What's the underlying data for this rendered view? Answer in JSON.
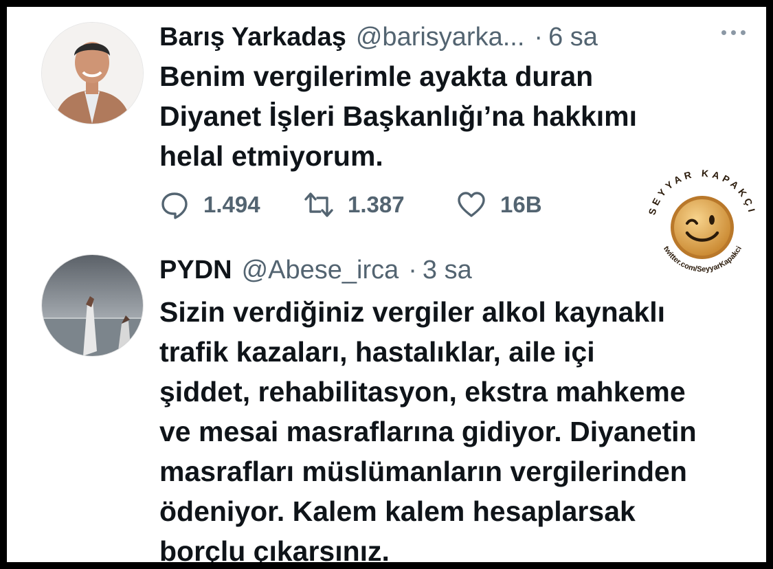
{
  "tweets": [
    {
      "author_name": "Barış Yarkadaş",
      "handle": "@barisyarka...",
      "separator": "·",
      "time": "6 sa",
      "text": "Benim vergilerimle ayakta duran\nDiyanet İşleri Başkanlığı’na hakkımı\nhelal etmiyorum.",
      "replies": "1.494",
      "retweets": "1.387",
      "likes": "16B"
    },
    {
      "author_name": "PYDN",
      "handle": "@Abese_irca",
      "separator": "·",
      "time": "3 sa",
      "text": "Sizin verdiğiniz vergiler alkol kaynaklı\ntrafik kazaları, hastalıklar, aile içi\nşiddet, rehabilitasyon, ekstra mahkeme\nve mesai masraflarına gidiyor. Diyanetin\nmasrafları müslümanların vergilerinden\nödeniyor. Kalem kalem hesaplarsak\nborçlu çıkarsınız."
    }
  ],
  "watermark": {
    "brand": "SEYYAR KAPAKÇI",
    "url": "twitter.com/SeyyarKapakci",
    "icon": "winking-bottle-cap-icon"
  },
  "colors": {
    "text": "#0f1419",
    "secondary": "#536471",
    "frame": "#000000",
    "cap": "#e0a34a"
  }
}
